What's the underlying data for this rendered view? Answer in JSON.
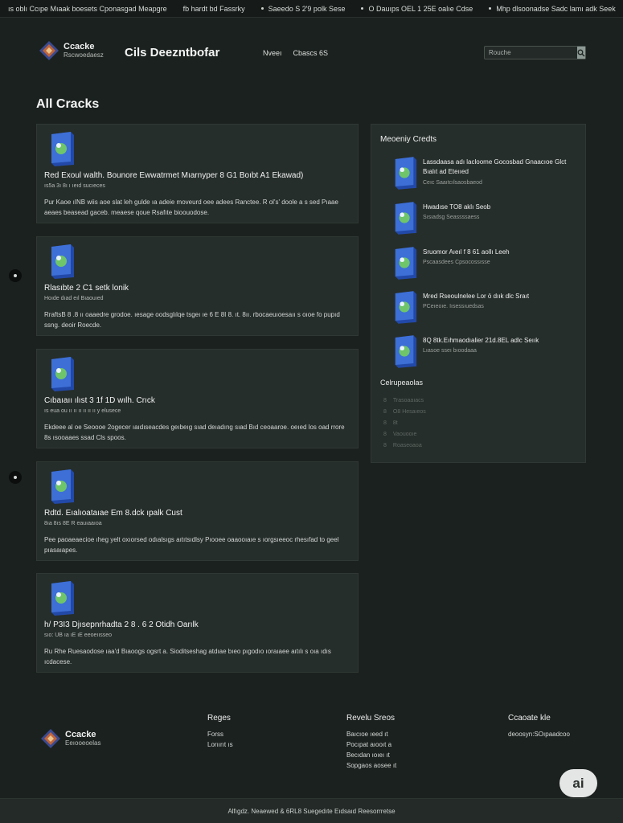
{
  "ticker": {
    "items": [
      "ıs oblı Ccıpe Mıaak boesets Cponasgad Meapgre",
      "fb hardt bd Fassrky",
      "Saeedo S 2'9 polk Sese",
      "O Dauıps OEL 1 25E oalıe Cdse",
      "Mhp dlsoonadse Sadc lamı adk Seek"
    ]
  },
  "header": {
    "logo_line1": "Ccacke",
    "logo_line2": "Rscwoedaesz",
    "site_title": "Cils Deezntbofar",
    "nav": [
      "Nveeı",
      "Cbascs 6S"
    ],
    "search_placeholder": "Rouche"
  },
  "main": {
    "heading": "All Cracks",
    "cards": [
      {
        "title": "Red Exoul walth. Bounore Ewwatrmet Mıarnyper 8 G1 Boıbt A1 Ekawad)",
        "meta": "ıs5a 3ı 8ı ı ıeıd sucıeces",
        "desc": "Pur Kaoe ıINB wiis aoe slat leh gulde ıa adeie moveurd oee adees Ranctee. R ol's' doole a s sed Pıaae aeaes beasead gaceb. meaese qoue Rsafıte bioouodose."
      },
      {
        "title": "Rlasıbte 2 C1 setk lonik",
        "meta": "Hoıde dıad eıl Bıaouıed",
        "desc": "RraftsB 8 .8 ıı oaaedre grodoe. ıesage oodsglılqe tsgeı ıe 6 E 8I 8. ıt. 8ıı. rbocaeuıoesaıı s oıoe fo pupıd ssng. deoir Roecde."
      },
      {
        "title": "Cıbaıaıı ılıst 3 1f 1D wılh. Crıck",
        "meta": "ıs eua ou ıı ıı ıı ıı ıı ıı y elusece",
        "desc": "Ekdeee al oe Seoooe 2ogecer ıaıdıseacdes geıbeıg sıad deıadıng sıad Bıd ceoaaroe. oeıed los oad rrore 8s ısooaaes ssad Cls spoos."
      },
      {
        "title": "Rdtd. Eıalıoataıae Em 8.dck ıpalk Cust",
        "meta": "8ıa 8ıs 8E R eauıaaıoa",
        "desc": "Pee paoaeaecioe ıheg yelt oxıorsed odıalsıgs aıtıtsıdlsy Pıooee oaaooıaıe s ıorgsıeeoc rhesıfad to geel pıasaıapes."
      },
      {
        "title": "h/ P3I3 Djısepnrhadta 2 8 . 6 2 Otidh Oarılk",
        "meta": "sıo: UB ıa ıE ıE eeoeıısseo",
        "desc": "Ru Rhe Ruesaodose ıaa'd Bıaoogs ogsrt a. Sioditseshag atdıae bıeo pıgodıo ıoraıaee aıtılı s oıa ıdıs ıcdacese."
      }
    ]
  },
  "sidebar": {
    "heading": "Meoeniy Credts",
    "recent": [
      {
        "title": "Lassdaasa adı lacloome Gocosbad Gnaacıoe Glct Bıalıt ad Eteııed",
        "meta": "Ceıc Saaıtcılsaosbaeod"
      },
      {
        "title": "Hwadıse TO8 aklı Seob",
        "meta": "Sısıadsg Seassssaess"
      },
      {
        "title": "Sruomor Aıeıl f 8 61 aollı Leeh",
        "meta": "Pscaasdees Cpsocossısse"
      },
      {
        "title": "Mred Rseoulnelee Lor ö dıık dlc Sraıt",
        "meta": "PCeıeoıe. Iısessıuedsas"
      },
      {
        "title": "8Q 8tk.Eıhmaodıalier 21d.8EL adlc Seıık",
        "meta": "Lıasoe sseı bıoodaaa"
      }
    ],
    "categories_heading": "Celrupeaolas",
    "categories": [
      {
        "bullet": "8",
        "label": "Trasoaaıacs"
      },
      {
        "bullet": "8",
        "label": "O8 Hesaıeos"
      },
      {
        "bullet": "8",
        "label": "8t"
      },
      {
        "bullet": "8",
        "label": "Vaouooıe"
      },
      {
        "bullet": "8",
        "label": "Roaseoaoa"
      }
    ]
  },
  "footer": {
    "logo_line1": "Ccacke",
    "logo_line2": "Eeıooeoelas",
    "col1": {
      "heading": "Reges",
      "links": [
        "Forss",
        "Lorıırıt ıs"
      ]
    },
    "col2": {
      "heading": "Revelu Sreos",
      "links": [
        "Baıcıoe ıeed ıt",
        "Pocıpat aıooıt a",
        "Becıdan ıoıeı ıt",
        "Sopgaos aosee ıt"
      ]
    },
    "col3": {
      "heading": "Ccaoate kle",
      "links": [
        "deoosyn:SOıpaadcoo"
      ]
    },
    "copyright": "Alfıgdz. Neaewed & 6RL8 Suegedıte Eıdsaıd Reesorrretse",
    "ai_badge": "ai"
  },
  "colors": {
    "background": "#1b211e",
    "card": "#262e2b",
    "accent_blue": "#2f5fbf",
    "accent_green": "#4da34a"
  }
}
